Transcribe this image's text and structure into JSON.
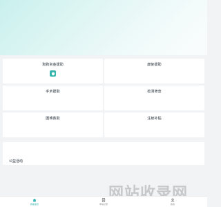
{
  "services": [
    {
      "label": "狗狗资金援助",
      "has_icon": true
    },
    {
      "label": "康复援助"
    },
    {
      "label": "手术援助"
    },
    {
      "label": "检测筛查"
    },
    {
      "label": "困难救助"
    },
    {
      "label": "注射补贴"
    }
  ],
  "section": {
    "title": "公益活动"
  },
  "watermark": "网站收录网",
  "tabbar": {
    "items": [
      {
        "label": "救助首页",
        "icon": "home-icon",
        "active": true
      },
      {
        "label": "申请记录",
        "icon": "document-icon",
        "active": false
      },
      {
        "label": "我的",
        "icon": "user-icon",
        "active": false
      }
    ]
  },
  "colors": {
    "accent": "#33b4ae",
    "card": "#ffffff",
    "background": "#f2f3f5"
  }
}
